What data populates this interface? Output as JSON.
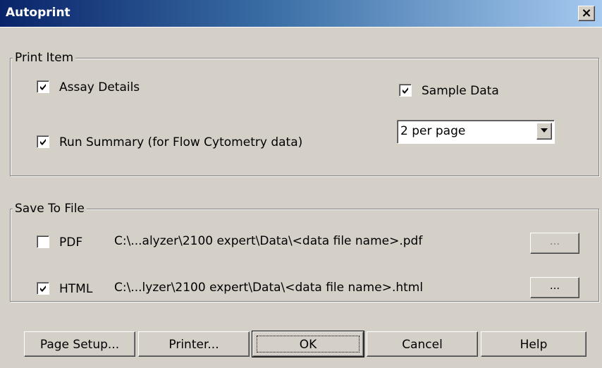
{
  "window": {
    "title": "Autoprint",
    "close_label": "×"
  },
  "print_item": {
    "legend": "Print Item",
    "assay_details": {
      "label": "Assay Details",
      "checked": true
    },
    "sample_data": {
      "label": "Sample Data",
      "checked": true
    },
    "run_summary": {
      "label": "Run Summary (for Flow Cytometry data)",
      "checked": true
    },
    "per_page": {
      "value": "2 per page"
    }
  },
  "save_to_file": {
    "legend": "Save To File",
    "pdf": {
      "label": "PDF",
      "checked": false,
      "path": "C:\\...alyzer\\2100 expert\\Data\\<data file name>.pdf",
      "browse_label": "...",
      "browse_enabled": false
    },
    "html": {
      "label": "HTML",
      "checked": true,
      "path": "C:\\...lyzer\\2100 expert\\Data\\<data file name>.html",
      "browse_label": "...",
      "browse_enabled": true
    }
  },
  "buttons": {
    "page_setup": "Page Setup...",
    "printer": "Printer...",
    "ok": "OK",
    "cancel": "Cancel",
    "help": "Help"
  }
}
